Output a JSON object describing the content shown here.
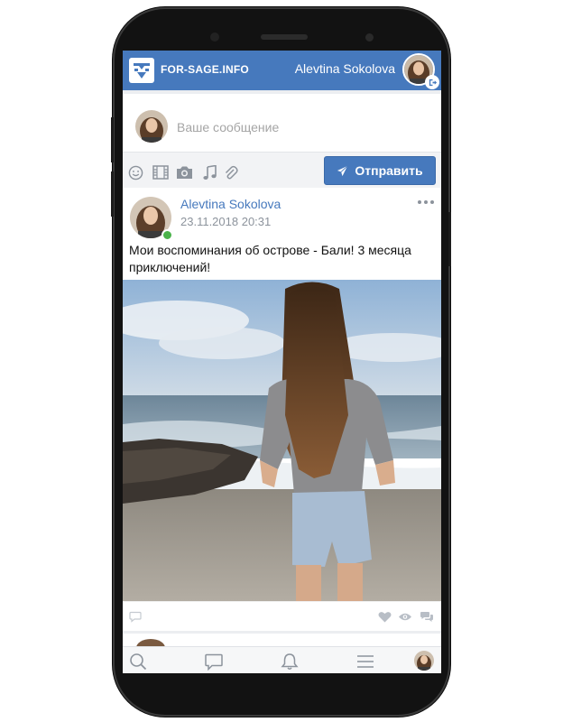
{
  "header": {
    "site_name": "FOR-SAGE.INFO",
    "user_name": "Alevtina Sokolova",
    "logo_icon": "site-logo-icon",
    "logout_icon": "logout-icon"
  },
  "composer": {
    "placeholder": "Ваше сообщение",
    "send_label": "Отправить",
    "tools": [
      "smile-icon",
      "video-icon",
      "camera-icon",
      "music-icon",
      "paperclip-icon"
    ]
  },
  "post": {
    "author": "Alevtina Sokolova",
    "date": "23.11.2018 20:31",
    "text": "Мои воспоминания об острове - Бали! 3 месяца приключений!",
    "status": "online",
    "footer_icons": [
      "comment-icon",
      "like-icon",
      "views-icon",
      "share-icon"
    ]
  },
  "bottom_nav": [
    "search-icon",
    "messages-icon",
    "notifications-icon",
    "menu-icon",
    "profile-avatar"
  ],
  "colors": {
    "brand": "#4679bd",
    "online": "#4bb34b",
    "muted": "#8c939c"
  }
}
